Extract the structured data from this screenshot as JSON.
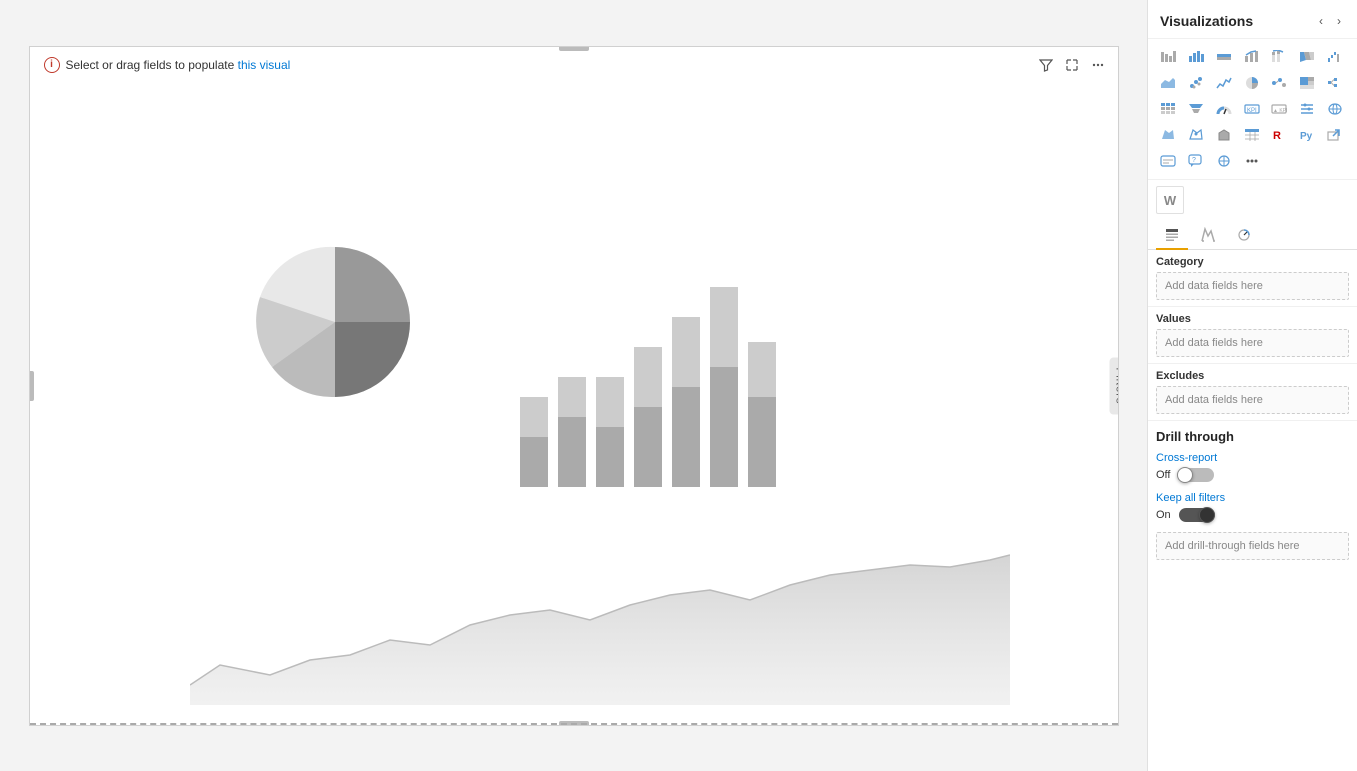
{
  "main": {
    "info_text": "Select or drag fields to populate this visual",
    "info_link_text": "this visual"
  },
  "toolbar": {
    "filter_icon": "⊞",
    "expand_icon": "⤢",
    "more_icon": "…"
  },
  "filters_tab": {
    "label": "Filters"
  },
  "right_panel": {
    "title": "Visualizations",
    "tabs": {
      "fields_label": "Fields",
      "format_label": "Format",
      "analytics_label": "Analytics"
    },
    "fields": {
      "category_label": "Category",
      "category_placeholder": "Add data fields here",
      "values_label": "Values",
      "values_placeholder": "Add data fields here",
      "excludes_label": "Excludes",
      "excludes_placeholder": "Add data fields here"
    },
    "drill_through": {
      "title": "Drill through",
      "cross_report_label": "Cross-report",
      "off_label": "Off",
      "on_label": "On",
      "keep_all_filters_label": "Keep all filters",
      "drill_placeholder": "Add drill-through fields here"
    }
  }
}
